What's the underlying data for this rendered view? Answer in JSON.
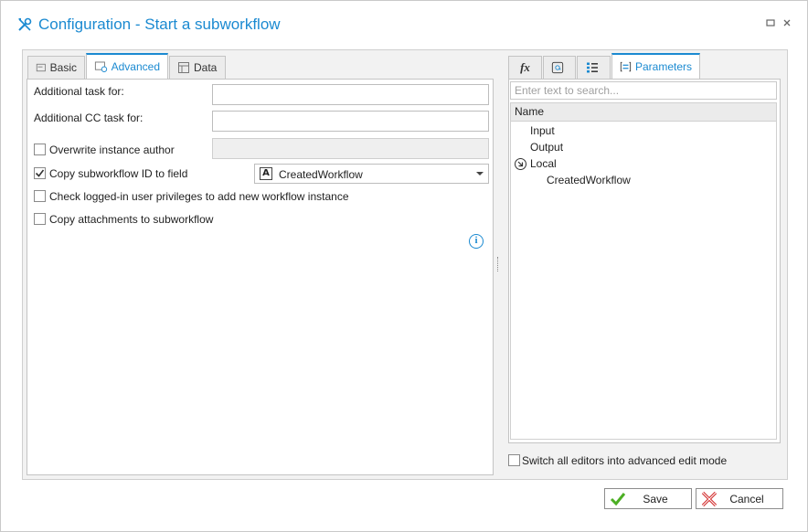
{
  "window": {
    "title": "Configuration - Start a subworkflow"
  },
  "left_tabs": [
    {
      "label": "Basic",
      "icon": "form-icon"
    },
    {
      "label": "Advanced",
      "icon": "advanced-settings-icon"
    },
    {
      "label": "Data",
      "icon": "table-icon"
    }
  ],
  "left_tabs_active": "Advanced",
  "form": {
    "additional_task_label": "Additional task for:",
    "additional_task_value": "",
    "additional_cc_label": "Additional CC task for:",
    "additional_cc_value": "",
    "overwrite_author_label": "Overwrite instance author",
    "overwrite_author_checked": false,
    "copy_id_label": "Copy subworkflow ID to field",
    "copy_id_checked": true,
    "copy_id_field": "CreatedWorkflow",
    "check_privileges_label": "Check logged-in user privileges to add new workflow instance",
    "check_privileges_checked": false,
    "copy_attachments_label": "Copy attachments to subworkflow",
    "copy_attachments_checked": false
  },
  "right_tabs": [
    {
      "label": "",
      "icon": "fx-icon"
    },
    {
      "label": "",
      "icon": "at-sign-icon"
    },
    {
      "label": "",
      "icon": "list-icon"
    },
    {
      "label": "Parameters",
      "icon": "parameters-icon"
    }
  ],
  "right_panel": {
    "search_placeholder": "Enter text to search...",
    "column_header": "Name",
    "tree": [
      {
        "label": "Input",
        "level": 0
      },
      {
        "label": "Output",
        "level": 0
      },
      {
        "label": "Local",
        "level": 0,
        "expanded": true
      },
      {
        "label": "CreatedWorkflow",
        "level": 1
      }
    ],
    "advanced_mode_label": "Switch all editors into advanced edit mode",
    "advanced_mode_checked": false
  },
  "buttons": {
    "save": "Save",
    "cancel": "Cancel"
  },
  "colors": {
    "accent": "#1b8ad1",
    "save_check": "#4caf24",
    "cancel_x": "#d32f2f"
  }
}
